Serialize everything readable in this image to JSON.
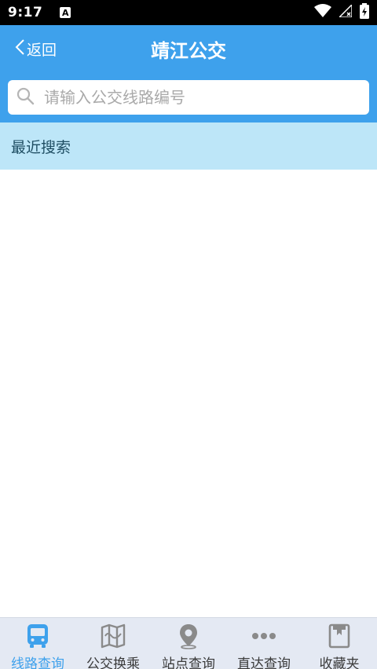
{
  "status_bar": {
    "time": "9:17",
    "notification_letter": "A"
  },
  "header": {
    "back_label": "返回",
    "title": "靖江公交"
  },
  "search": {
    "placeholder": "请输入公交线路编号",
    "value": ""
  },
  "recent": {
    "header": "最近搜索",
    "items": []
  },
  "tabs": [
    {
      "label": "线路查询",
      "icon": "bus-icon",
      "active": true
    },
    {
      "label": "公交换乘",
      "icon": "map-book-icon",
      "active": false
    },
    {
      "label": "站点查询",
      "icon": "location-pin-icon",
      "active": false
    },
    {
      "label": "直达查询",
      "icon": "dots-icon",
      "active": false
    },
    {
      "label": "收藏夹",
      "icon": "bookmark-folder-icon",
      "active": false
    }
  ],
  "colors": {
    "primary": "#3ea1ec",
    "recent_header_bg": "#bde6f8",
    "tab_bar_bg": "#e4e9f3",
    "tab_icon_inactive": "#8a8a8a"
  }
}
